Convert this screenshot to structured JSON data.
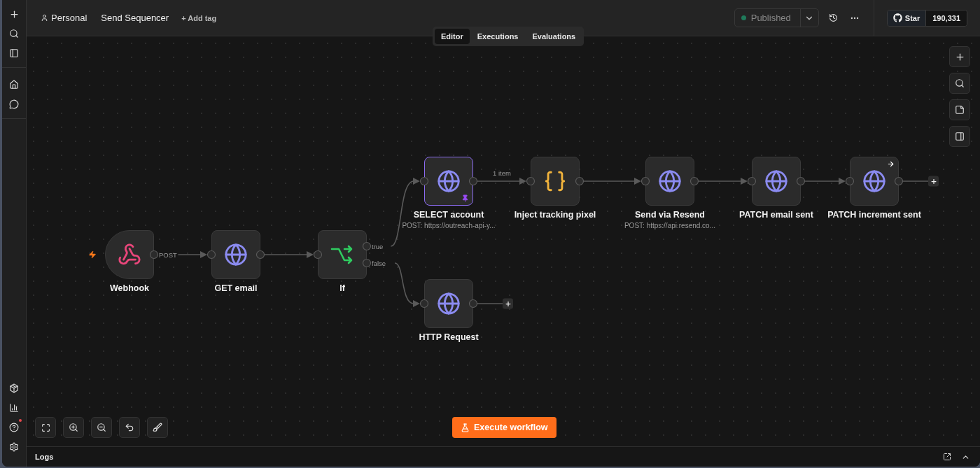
{
  "header": {
    "project": "Personal",
    "workflow_name": "Send Sequencer",
    "add_tag": "+ Add tag",
    "status": "Published",
    "github_label": "Star",
    "github_count": "190,331"
  },
  "tabs": [
    {
      "label": "Editor",
      "selected": true
    },
    {
      "label": "Executions",
      "selected": false
    },
    {
      "label": "Evaluations",
      "selected": false
    }
  ],
  "nodes": [
    {
      "kind": "webhook",
      "label": "Webhook",
      "outputs": [
        "POST"
      ],
      "selected": false,
      "pinned": false,
      "open_output": false,
      "arrow_badge": false
    },
    {
      "kind": "http",
      "label": "GET email",
      "selected": false,
      "pinned": false,
      "open_output": false,
      "arrow_badge": false
    },
    {
      "kind": "if",
      "label": "If",
      "outputs": [
        "true",
        "false"
      ],
      "selected": false,
      "pinned": false,
      "open_output": false,
      "arrow_badge": false
    },
    {
      "kind": "http",
      "label": "SELECT account",
      "subtitle": "POST: https://outreach-api-y...",
      "connection_label": "1 item",
      "selected": true,
      "pinned": true,
      "open_output": false,
      "arrow_badge": false
    },
    {
      "kind": "code",
      "label": "Inject tracking pixel",
      "selected": false,
      "pinned": false,
      "open_output": false,
      "arrow_badge": false
    },
    {
      "kind": "http",
      "label": "Send via Resend",
      "subtitle": "POST: https://api.resend.co...",
      "selected": false,
      "pinned": false,
      "open_output": false,
      "arrow_badge": false
    },
    {
      "kind": "http",
      "label": "PATCH email sent",
      "selected": false,
      "pinned": false,
      "open_output": false,
      "arrow_badge": false
    },
    {
      "kind": "http",
      "label": "PATCH increment sent",
      "selected": false,
      "pinned": false,
      "open_output": true,
      "arrow_badge": true
    },
    {
      "kind": "http",
      "label": "HTTP Request",
      "selected": false,
      "pinned": false,
      "open_output": true,
      "arrow_badge": false
    }
  ],
  "execute_button": "Execute workflow",
  "logs": {
    "title": "Logs"
  }
}
